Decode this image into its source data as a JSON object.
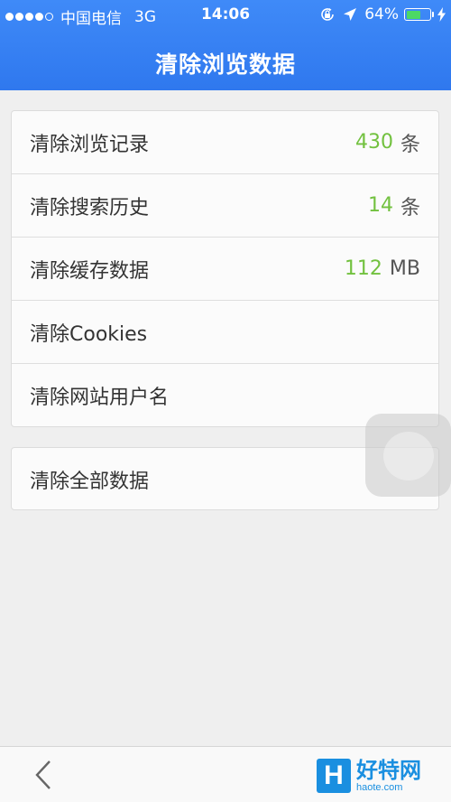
{
  "status_bar": {
    "carrier": "中国电信",
    "network": "3G",
    "time": "14:06",
    "battery_percent": "64%",
    "battery_level": 0.64
  },
  "header": {
    "title": "清除浏览数据"
  },
  "items": [
    {
      "label": "清除浏览记录",
      "count": "430",
      "unit": "条"
    },
    {
      "label": "清除搜索历史",
      "count": "14",
      "unit": "条"
    },
    {
      "label": "清除缓存数据",
      "count": "112",
      "unit": "MB"
    },
    {
      "label": "清除Cookies"
    },
    {
      "label": "清除网站用户名"
    }
  ],
  "clear_all": {
    "label": "清除全部数据"
  },
  "watermark": {
    "name": "好特网",
    "url": "haote.com"
  },
  "colors": {
    "header": "#3584f4",
    "count": "#72c13f",
    "background": "#efefef"
  },
  "icons": [
    "orientation-lock-icon",
    "location-arrow-icon",
    "battery-icon",
    "charging-bolt-icon",
    "back-chevron-icon"
  ]
}
